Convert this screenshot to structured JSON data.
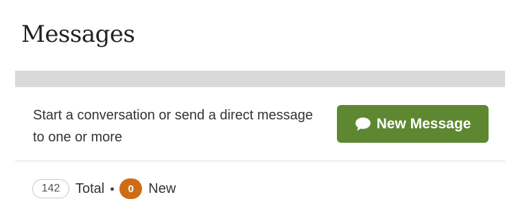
{
  "page": {
    "title": "Messages"
  },
  "compose": {
    "description": "Start a conversation or send a direct message to one or more",
    "button_label": "New Message",
    "button_icon": "chat-bubble-icon",
    "button_color": "#5e8731"
  },
  "stats": {
    "total_count": "142",
    "total_label": "Total",
    "new_count": "0",
    "new_label": "New",
    "new_badge_color": "#cf6b17"
  }
}
